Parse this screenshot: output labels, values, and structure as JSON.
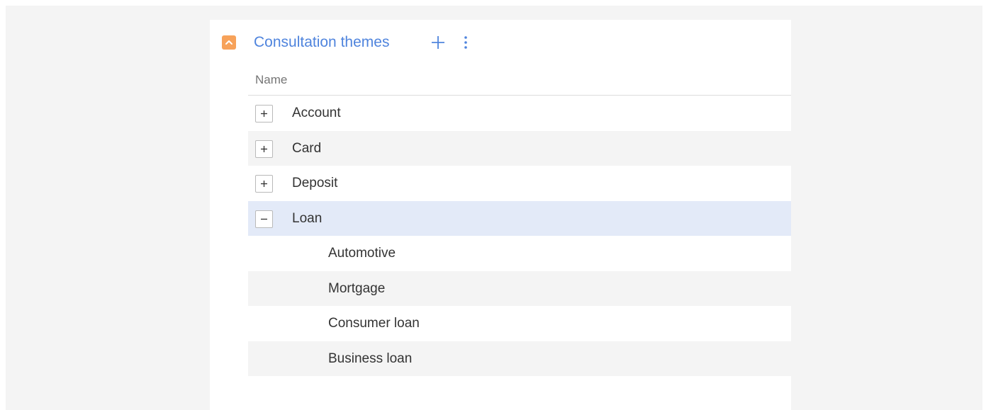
{
  "detail": {
    "title": "Consultation themes",
    "toggle_icon": "chevron-up-icon",
    "add_icon": "plus-icon",
    "more_icon": "vertical-dots-icon"
  },
  "grid": {
    "column_header": "Name",
    "rows": [
      {
        "label": "Account",
        "expander": "plus",
        "level": 0,
        "selected": false
      },
      {
        "label": "Card",
        "expander": "plus",
        "level": 0,
        "selected": false
      },
      {
        "label": "Deposit",
        "expander": "plus",
        "level": 0,
        "selected": false
      },
      {
        "label": "Loan",
        "expander": "minus",
        "level": 0,
        "selected": true
      },
      {
        "label": "Automotive",
        "expander": null,
        "level": 1,
        "selected": false
      },
      {
        "label": "Mortgage",
        "expander": null,
        "level": 1,
        "selected": false
      },
      {
        "label": "Consumer loan",
        "expander": null,
        "level": 1,
        "selected": false
      },
      {
        "label": "Business loan",
        "expander": null,
        "level": 1,
        "selected": false
      }
    ]
  },
  "colors": {
    "accent_orange": "#f7a25a",
    "title_blue": "#4f84dd",
    "selected_row": "#e3eaf8",
    "alt_row": "#f4f4f4"
  }
}
